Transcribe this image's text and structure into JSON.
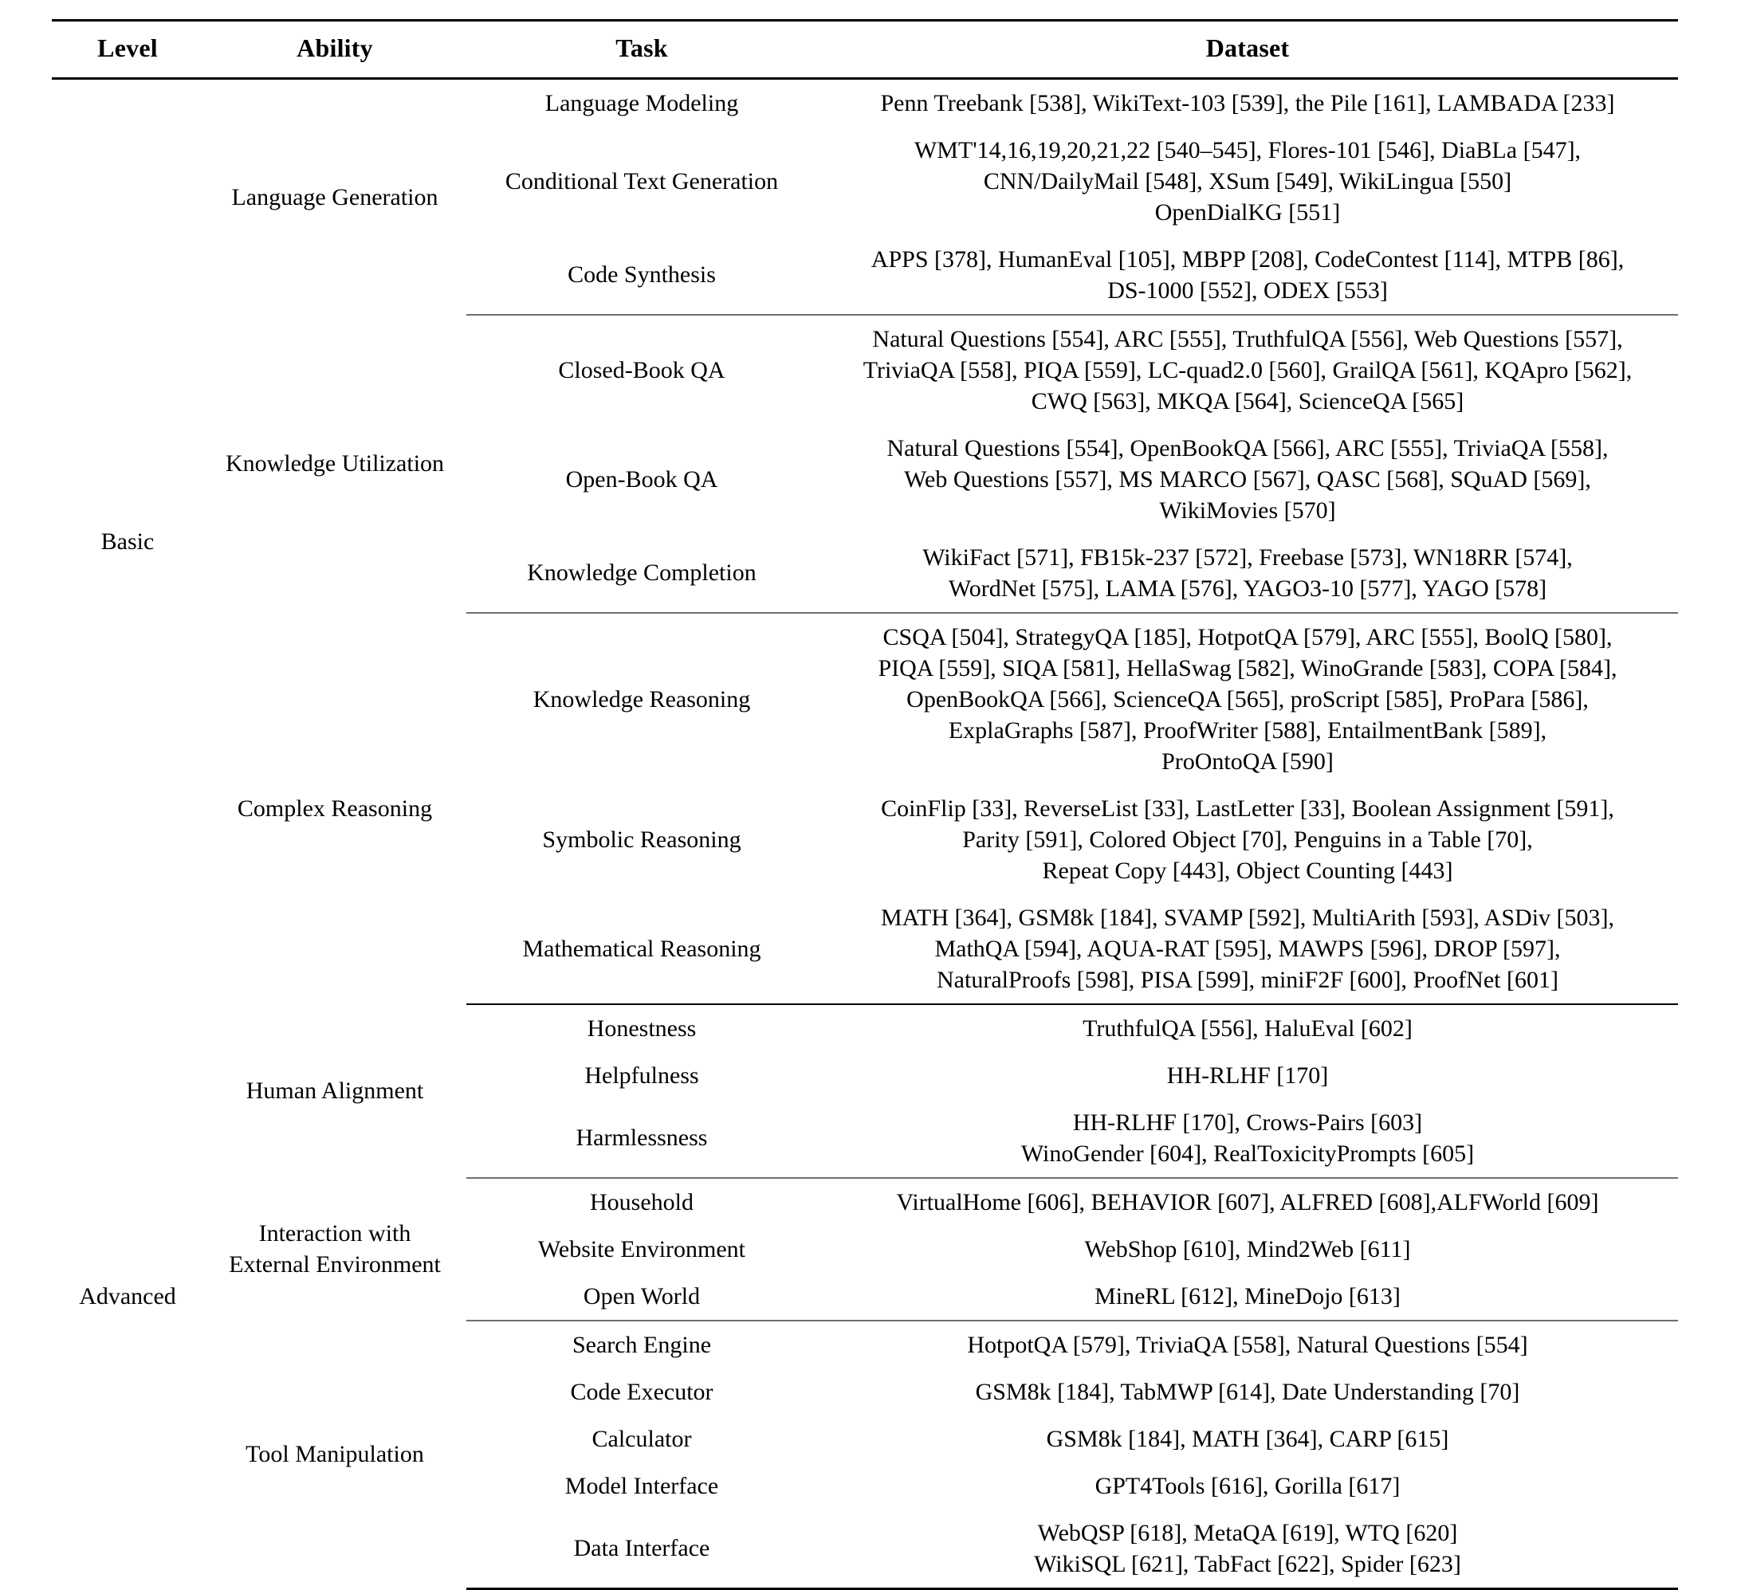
{
  "table": {
    "headers": {
      "level": "Level",
      "ability": "Ability",
      "task": "Task",
      "dataset": "Dataset"
    },
    "levels": [
      {
        "id": "basic",
        "label": "Basic"
      },
      {
        "id": "advanced",
        "label": "Advanced"
      }
    ],
    "abilities": [
      {
        "id": "language-generation",
        "label": "Language Generation"
      },
      {
        "id": "knowledge-utilization",
        "label": "Knowledge Utilization"
      },
      {
        "id": "complex-reasoning",
        "label": "Complex Reasoning"
      },
      {
        "id": "human-alignment",
        "label": "Human Alignment"
      },
      {
        "id": "interaction-external-environment",
        "line1": "Interaction with",
        "line2": "External Environment"
      },
      {
        "id": "tool-manipulation",
        "label": "Tool Manipulation"
      }
    ],
    "tasks": {
      "language_modeling": "Language Modeling",
      "conditional_text_generation": "Conditional Text Generation",
      "code_synthesis": "Code Synthesis",
      "closed_book_qa": "Closed-Book QA",
      "open_book_qa": "Open-Book QA",
      "knowledge_completion": "Knowledge Completion",
      "knowledge_reasoning": "Knowledge Reasoning",
      "symbolic_reasoning": "Symbolic Reasoning",
      "mathematical_reasoning": "Mathematical Reasoning",
      "honestness": "Honestness",
      "helpfulness": "Helpfulness",
      "harmlessness": "Harmlessness",
      "household": "Household",
      "website_environment": "Website Environment",
      "open_world": "Open World",
      "search_engine": "Search Engine",
      "code_executor": "Code Executor",
      "calculator": "Calculator",
      "model_interface": "Model Interface",
      "data_interface": "Data Interface"
    },
    "datasets": {
      "language_modeling": [
        "Penn Treebank [538], WikiText-103 [539], the Pile [161], LAMBADA [233]"
      ],
      "conditional_text_generation": [
        "WMT'14,16,19,20,21,22 [540–545], Flores-101 [546], DiaBLa [547],",
        "CNN/DailyMail [548], XSum [549], WikiLingua [550]",
        "OpenDialKG [551]"
      ],
      "code_synthesis": [
        "APPS [378], HumanEval [105], MBPP [208], CodeContest [114], MTPB [86],",
        "DS-1000 [552], ODEX [553]"
      ],
      "closed_book_qa": [
        "Natural Questions [554], ARC [555], TruthfulQA [556], Web Questions [557],",
        "TriviaQA [558], PIQA [559], LC-quad2.0 [560], GrailQA [561], KQApro [562],",
        "CWQ [563], MKQA [564], ScienceQA [565]"
      ],
      "open_book_qa": [
        "Natural Questions [554], OpenBookQA [566], ARC [555], TriviaQA [558],",
        "Web Questions [557], MS MARCO [567], QASC [568], SQuAD [569],",
        "WikiMovies [570]"
      ],
      "knowledge_completion": [
        "WikiFact [571], FB15k-237 [572], Freebase [573], WN18RR [574],",
        "WordNet [575], LAMA [576], YAGO3-10 [577], YAGO [578]"
      ],
      "knowledge_reasoning": [
        "CSQA [504], StrategyQA [185], HotpotQA [579], ARC [555], BoolQ [580],",
        "PIQA [559], SIQA [581], HellaSwag [582], WinoGrande [583], COPA [584],",
        "OpenBookQA [566], ScienceQA [565], proScript [585], ProPara [586],",
        "ExplaGraphs [587], ProofWriter [588], EntailmentBank [589],",
        "ProOntoQA [590]"
      ],
      "symbolic_reasoning": [
        "CoinFlip [33], ReverseList [33], LastLetter [33], Boolean Assignment [591],",
        "Parity [591], Colored Object [70], Penguins in a Table [70],",
        "Repeat Copy [443], Object Counting [443]"
      ],
      "mathematical_reasoning": [
        "MATH [364], GSM8k [184], SVAMP [592], MultiArith [593], ASDiv [503],",
        "MathQA [594], AQUA-RAT [595], MAWPS [596], DROP [597],",
        "NaturalProofs [598], PISA [599], miniF2F [600], ProofNet [601]"
      ],
      "honestness": [
        "TruthfulQA [556], HaluEval [602]"
      ],
      "helpfulness": [
        "HH-RLHF [170]"
      ],
      "harmlessness": [
        "HH-RLHF [170], Crows-Pairs [603]",
        "WinoGender [604], RealToxicityPrompts [605]"
      ],
      "household": [
        "VirtualHome [606], BEHAVIOR [607], ALFRED [608],ALFWorld [609]"
      ],
      "website_environment": [
        "WebShop [610], Mind2Web [611]"
      ],
      "open_world": [
        "MineRL [612], MineDojo [613]"
      ],
      "search_engine": [
        "HotpotQA [579], TriviaQA [558], Natural Questions [554]"
      ],
      "code_executor": [
        "GSM8k [184], TabMWP [614], Date Understanding [70]"
      ],
      "calculator": [
        "GSM8k [184], MATH [364], CARP [615]"
      ],
      "model_interface": [
        "GPT4Tools [616], Gorilla [617]"
      ],
      "data_interface": [
        "WebQSP [618], MetaQA [619], WTQ [620]",
        "WikiSQL [621], TabFact [622], Spider [623]"
      ]
    }
  }
}
